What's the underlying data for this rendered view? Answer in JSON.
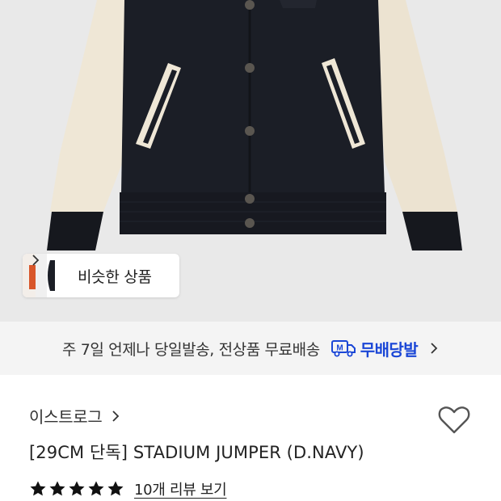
{
  "similar": {
    "label": "비슷한 상품",
    "icon": "chevron-right-icon"
  },
  "shipping_banner": {
    "text": "주 7일 언제나 당일발송, 전상품 무료배송",
    "badge_label": "무배당발",
    "badge_icon": "truck-icon",
    "badge_color": "#1a46d6"
  },
  "product": {
    "brand": "이스트로그",
    "title": "[29CM 단독] STADIUM JUMPER (D.NAVY)",
    "rating": 5,
    "rating_max": 5,
    "review_link": "10개 리뷰 보기"
  },
  "colors": {
    "jacket_body": "#1b1e26",
    "jacket_sleeve": "#efe7d6",
    "background": "#e9e9e9",
    "banner_bg": "#f4f4f4"
  }
}
